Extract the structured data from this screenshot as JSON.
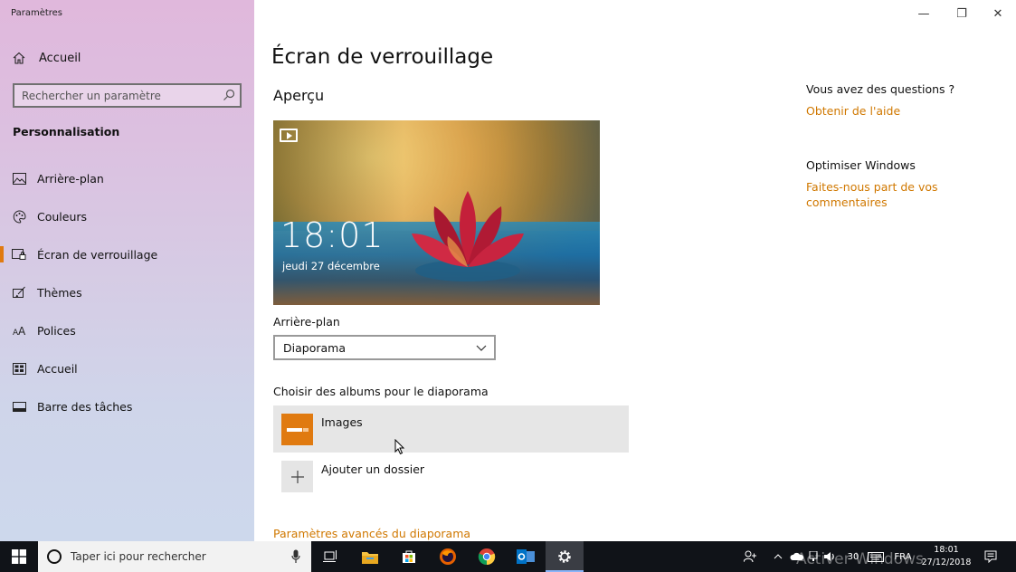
{
  "window": {
    "app_title": "Paramètres",
    "controls": {
      "minimize": "—",
      "restore": "❐",
      "close": "✕"
    }
  },
  "sidebar": {
    "home_label": "Accueil",
    "search_placeholder": "Rechercher un paramètre",
    "section_title": "Personnalisation",
    "items": [
      {
        "label": "Arrière-plan",
        "icon": "picture-icon"
      },
      {
        "label": "Couleurs",
        "icon": "palette-icon"
      },
      {
        "label": "Écran de verrouillage",
        "icon": "lock-screen-icon",
        "active": true
      },
      {
        "label": "Thèmes",
        "icon": "brush-icon"
      },
      {
        "label": "Polices",
        "icon": "font-icon"
      },
      {
        "label": "Accueil",
        "icon": "start-icon"
      },
      {
        "label": "Barre des tâches",
        "icon": "taskbar-icon"
      }
    ]
  },
  "main": {
    "page_title": "Écran de verrouillage",
    "preview_heading": "Aperçu",
    "preview": {
      "time": "18:01",
      "date": "jeudi 27 décembre"
    },
    "background_label": "Arrière-plan",
    "background_value": "Diaporama",
    "albums_label": "Choisir des albums pour le diaporama",
    "albums": [
      {
        "name": "Images",
        "icon": "folder-icon"
      }
    ],
    "add_folder_label": "Ajouter un dossier",
    "advanced_link": "Paramètres avancés du diaporama"
  },
  "help": {
    "question": "Vous avez des questions ?",
    "help_link": "Obtenir de l'aide",
    "improve_title": "Optimiser Windows",
    "feedback_link_line1": "Faites-nous part de vos",
    "feedback_link_line2": "commentaires"
  },
  "taskbar": {
    "search_placeholder": "Taper ici pour rechercher",
    "volume_level": "30",
    "language": "FRA",
    "time": "18:01",
    "date": "27/12/2018",
    "watermark": "Activer Windows"
  },
  "colors": {
    "accent": "#d07800",
    "taskbar": "#101318"
  }
}
